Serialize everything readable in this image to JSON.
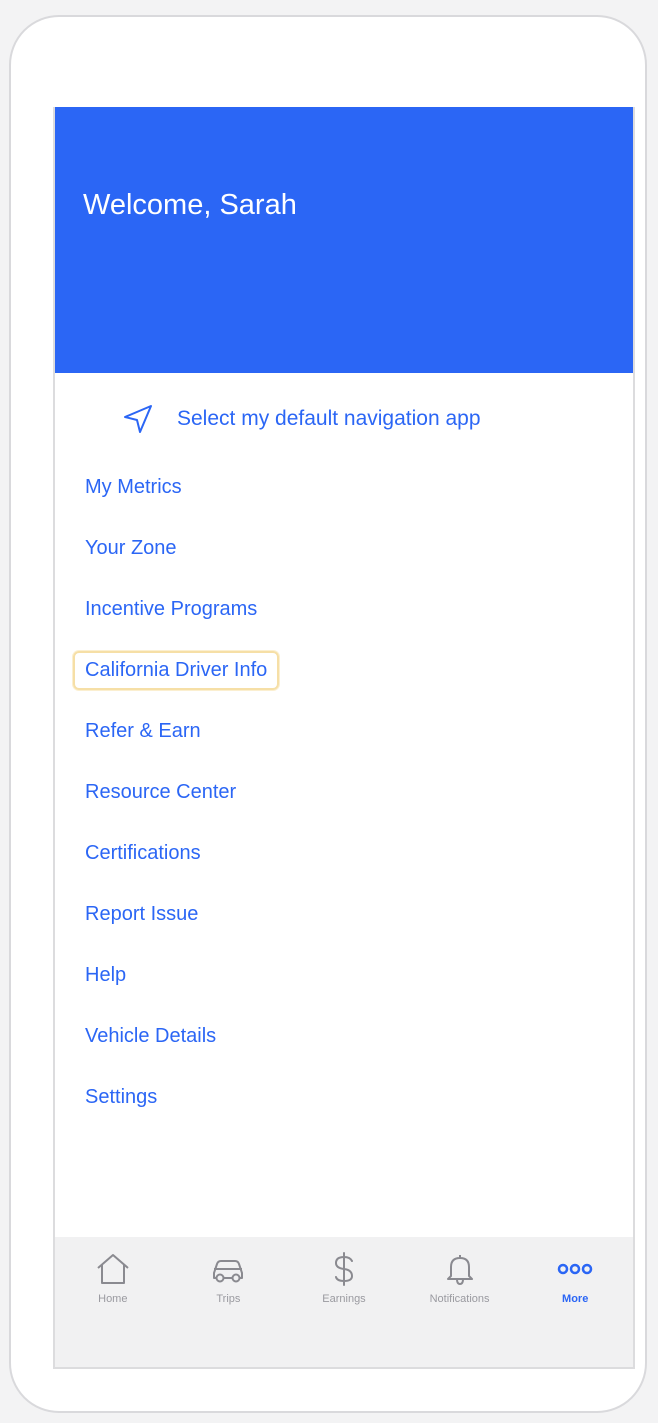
{
  "header": {
    "welcome": "Welcome, Sarah"
  },
  "nav_app": {
    "label": "Select my default navigation app",
    "icon": "navigation-arrow-icon"
  },
  "menu": {
    "items": [
      {
        "label": "My Metrics"
      },
      {
        "label": "Your Zone"
      },
      {
        "label": "Incentive Programs"
      },
      {
        "label": "California Driver Info",
        "focused": true
      },
      {
        "label": "Refer & Earn"
      },
      {
        "label": "Resource Center"
      },
      {
        "label": "Certifications"
      },
      {
        "label": "Report Issue"
      },
      {
        "label": "Help"
      },
      {
        "label": "Vehicle Details"
      },
      {
        "label": "Settings"
      }
    ]
  },
  "tabbar": {
    "tabs": [
      {
        "label": "Home",
        "icon": "home-icon"
      },
      {
        "label": "Trips",
        "icon": "car-icon"
      },
      {
        "label": "Earnings",
        "icon": "dollar-icon"
      },
      {
        "label": "Notifications",
        "icon": "bell-icon"
      },
      {
        "label": "More",
        "icon": "more-dots-icon",
        "active": true
      }
    ]
  },
  "colors": {
    "accent": "#2b66f5",
    "tabbar_bg": "#f1f1f2",
    "focus_ring": "#f6dfa6"
  }
}
